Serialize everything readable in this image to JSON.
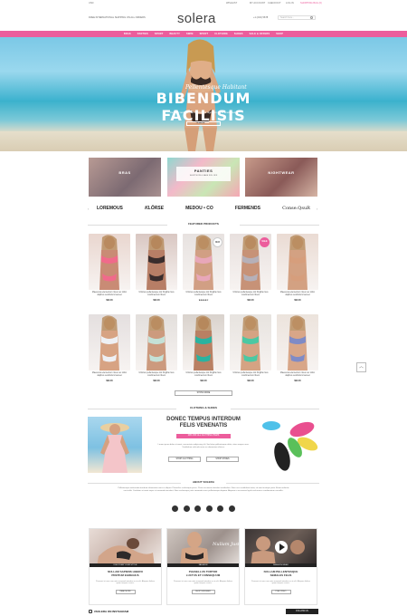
{
  "topbar": {
    "flag_label": "USD",
    "shipping_text": "FREE INTERNATIONAL SHIPPING ON ALL ORDERS",
    "links": [
      "WISHLIST",
      "MY ACCOUNT",
      "CHECKOUT",
      "LOG IN"
    ],
    "phone": "+1 (234) 5678",
    "cart": "SHOPPING BAG (0)"
  },
  "header": {
    "logo": "solera",
    "search_placeholder": "Search here..."
  },
  "nav": {
    "items": [
      "BRAS",
      "PANTIES",
      "SPORT",
      "BEAUTY",
      "SWIM",
      "SPORT",
      "CLOTHING",
      "SHOES",
      "SALE & OFFERS",
      "SHOP"
    ]
  },
  "hero": {
    "script": "Pellentesque Habitant",
    "title": "BIBENDUM FACILISIS",
    "subtitle": "Curabitur sed velit non nisl eleifend dignissim vel sit amet mauris",
    "button": "SHOP NOW"
  },
  "banners": [
    {
      "label": "BRAS",
      "sub": ""
    },
    {
      "label": "PANTIES",
      "sub": "SHOP NOW & SAVE 30% OFF"
    },
    {
      "label": "NIGHTWEAR",
      "sub": ""
    }
  ],
  "brands": [
    "LOREMOUS",
    "KLÖRSE",
    "MEDOU • CO",
    "FERMENDS",
    "Conse.QsuR"
  ],
  "featured": {
    "title": "FEATURED PRODUCTS",
    "row1": [
      {
        "name": "Maecenas elementum risus nec dolor dapibus vestibulum laoreet",
        "price": "$90.00",
        "badge": ""
      },
      {
        "name": "Ultricies pellentesque dui fringilla risus condimentum libero",
        "price": "$90.00",
        "badge": ""
      },
      {
        "name": "Ultricies pellentesque dui fringilla risus condimentum libero",
        "price": "★★★★☆",
        "badge": "NEW"
      },
      {
        "name": "Ultricies pellentesque dui fringilla risus condimentum libero",
        "price": "$90.00",
        "badge": "SALE"
      },
      {
        "name": "Maecenas elementum risus nec dolor dapibus vestibulum laoreet",
        "price": "$90.00",
        "badge": ""
      }
    ],
    "row2": [
      {
        "name": "Maecenas elementum risus nec dolor dapibus vestibulum laoreet",
        "price": "$90.00"
      },
      {
        "name": "Ultricies pellentesque dui fringilla risus condimentum libero",
        "price": "$90.00"
      },
      {
        "name": "Ultricies pellentesque dui fringilla risus condimentum libero",
        "price": "$90.00"
      },
      {
        "name": "Ultricies pellentesque dui fringilla risus condimentum libero",
        "price": "$90.00"
      },
      {
        "name": "Maecenas elementum risus nec dolor dapibus vestibulum laoreet",
        "price": "$90.00"
      }
    ],
    "show_more": "SHOW MORE"
  },
  "promo": {
    "section": "CLOTHING & SHOES",
    "title_line1": "DONEC TEMPUS INTERDUM",
    "title_line2": "FELIS VENENATIS",
    "tag": "20% OFF ALL CLOTHING ITEMS",
    "text": "Lorem ipsum dolor sit amet, consectetur adipiscing elit. Sed vitae pellentesque dolor, vitae semper urna. Vestibulum vehicula enim ac elementum ultrices.",
    "btn_clothing": "SHOP CLOTHING",
    "btn_shoes": "SHOP SHOES"
  },
  "about": {
    "title": "ABOUT SOLERA",
    "text": "Pellentesque malesuada tincidunt elementum nunc in aliquet. Phasellus scelerisque purus. Proin accumsan tincidunt vestibulum. Nunc nec vestibulum tortor, sit amet tristique justo. Etiam molestie erat nulla. Curabitur sit amet turpis ut commodo tincidunt. Nam scelerisque justo commodo nunc pellentesque aliquam. Aliquam in accumsan ligula sed mauris condimentum convallis."
  },
  "blog": [
    {
      "category": "DISCOVER YOUR STYLE",
      "title1": "NULLAM SAPIENS LIBERO",
      "title2": "PRETIUM EGREGIUS",
      "text": "Praesent ut nunc non ante euismod interdum eu in elit. Aliquam finibus quam tempus cursus.",
      "link": "READ MORE"
    },
    {
      "category": "FASHION",
      "title1": "PHASELLUS TORTOR",
      "title2": "LUCTUS ET CONSEQUUM",
      "text": "Praesent ut nunc non ante euismod interdum eu in elit. Aliquam finibus quam tempus cursus.",
      "link": "SHOP DESIGNER"
    },
    {
      "category": "FASHION WEEK",
      "title1": "NULLAM PELLENTESQUE",
      "title2": "SEMALES FELIS",
      "text": "Praesent ut nunc non ante euismod interdum eu in elit. Aliquam finibus quam tempus cursus.",
      "link": "PLAY VIDEO"
    }
  ],
  "instagram": {
    "title": "#SOLERA ON INSTAGRAM",
    "button": "FOLLOW US"
  },
  "colors": {
    "accent": "#ec5d9c",
    "dark": "#222222"
  }
}
